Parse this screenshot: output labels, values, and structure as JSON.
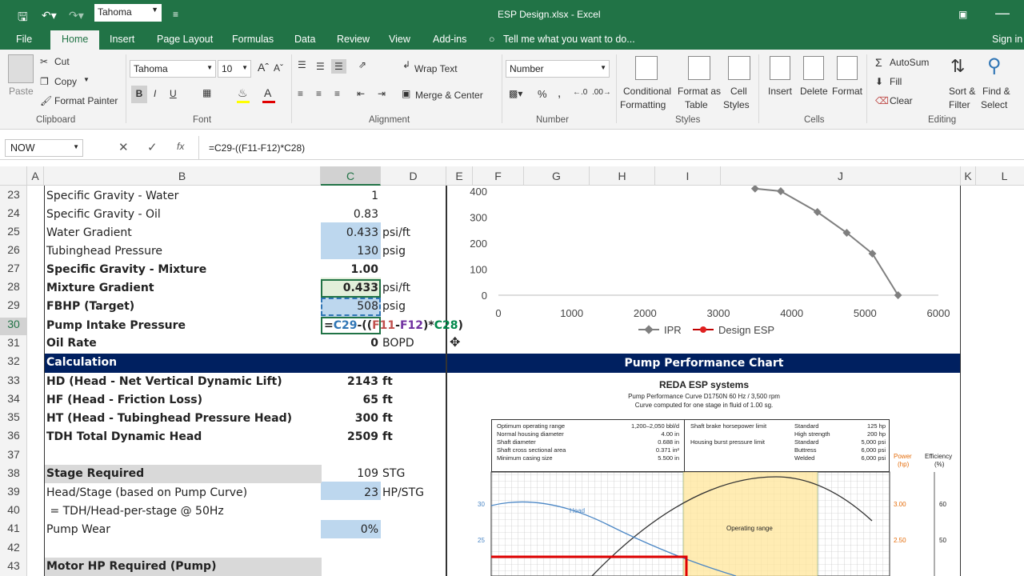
{
  "app": {
    "title": "ESP Design.xlsx - Excel",
    "font_box": "Tahoma",
    "signin": "Sign in"
  },
  "tabs": [
    "File",
    "Home",
    "Insert",
    "Page Layout",
    "Formulas",
    "Data",
    "Review",
    "View",
    "Add-ins"
  ],
  "tell_me": "Tell me what you want to do...",
  "ribbon": {
    "paste": "Paste",
    "cut": "Cut",
    "copy": "Copy",
    "format_painter": "Format Painter",
    "clipboard": "Clipboard",
    "font_name": "Tahoma",
    "font_size": "10",
    "bold": "B",
    "italic": "I",
    "underline": "U",
    "font": "Font",
    "wrap": "Wrap Text",
    "merge": "Merge & Center",
    "alignment": "Alignment",
    "numfmt": "Number",
    "number": "Number",
    "pct": "%",
    "comma": ",",
    "cond1": "Conditional",
    "cond2": "Formatting",
    "fat1": "Format as",
    "fat2": "Table",
    "cs1": "Cell",
    "cs2": "Styles",
    "styles": "Styles",
    "insert": "Insert",
    "delete": "Delete",
    "format": "Format",
    "cells": "Cells",
    "autosum": "AutoSum",
    "fill": "Fill",
    "clear": "Clear",
    "sort1": "Sort &",
    "sort2": "Filter",
    "find1": "Find &",
    "find2": "Select",
    "editing": "Editing"
  },
  "formula_bar": {
    "name_box": "NOW",
    "fx": "fx",
    "formula": "=C29-((F11-F12)*C28)"
  },
  "columns": [
    "A",
    "B",
    "C",
    "D",
    "E",
    "F",
    "G",
    "H",
    "I",
    "J",
    "K",
    "L"
  ],
  "rows": [
    "23",
    "24",
    "25",
    "26",
    "27",
    "28",
    "29",
    "30",
    "31",
    "32",
    "33",
    "34",
    "35",
    "36",
    "37",
    "38",
    "39",
    "40",
    "41",
    "42",
    "43"
  ],
  "cells": [
    {
      "b": "Specific Gravity - Water",
      "c": "1",
      "d": ""
    },
    {
      "b": "Specific Gravity - Oil",
      "c": "0.83",
      "d": ""
    },
    {
      "b": "Water Gradient",
      "c": "0.433",
      "d": "psi/ft"
    },
    {
      "b": "Tubinghead Pressure",
      "c": "130",
      "d": "psig"
    },
    {
      "b": "Specific Gravity - Mixture",
      "c": "1.00",
      "d": ""
    },
    {
      "b": "Mixture Gradient",
      "c": "0.433",
      "d": "psi/ft"
    },
    {
      "b": "FBHP (Target)",
      "c": "508",
      "d": "psig"
    },
    {
      "b": "Pump Intake Pressure",
      "c": "",
      "d": ""
    },
    {
      "b": "Oil Rate",
      "c": "0",
      "d": "BOPD"
    },
    {
      "b": "Calculation",
      "c": "",
      "d": ""
    },
    {
      "b": "HD (Head - Net Vertical Dynamic Lift)",
      "c": "2143",
      "d": "ft"
    },
    {
      "b": "HF (Head - Friction Loss)",
      "c": "65",
      "d": "ft"
    },
    {
      "b": "HT (Head - Tubinghead Pressure Head)",
      "c": "300",
      "d": "ft"
    },
    {
      "b": "TDH Total Dynamic Head",
      "c": "2509",
      "d": "ft"
    },
    {
      "b": "",
      "c": "",
      "d": ""
    },
    {
      "b": "Stage Required",
      "c": "109",
      "d": "STG"
    },
    {
      "b": "Head/Stage (based on Pump Curve)",
      "c": "23",
      "d": "HP/STG"
    },
    {
      "b": " = TDH/Head-per-stage @ 50Hz",
      "c": "",
      "d": ""
    },
    {
      "b": "Pump Wear",
      "c": "0%",
      "d": ""
    },
    {
      "b": "",
      "c": "",
      "d": ""
    },
    {
      "b": "Motor HP Required (Pump)",
      "c": "",
      "d": ""
    }
  ],
  "edit_formula": {
    "p1": "=",
    "p2": "C29",
    "p3": "-((",
    "p4": "F11",
    "p5": "-",
    "p6": "F12",
    "p7": ")*",
    "p8": "C28",
    "p9": ")"
  },
  "chart_data": {
    "type": "line",
    "ylim": [
      0,
      400
    ],
    "xlim": [
      0,
      6000
    ],
    "yticks": [
      "400",
      "300",
      "200",
      "100",
      "0"
    ],
    "xticks": [
      "0",
      "1000",
      "2000",
      "3000",
      "4000",
      "5000",
      "6000"
    ],
    "series": [
      {
        "name": "IPR",
        "x": [
          3500,
          3850,
          4350,
          4750,
          5100,
          5450
        ],
        "y": [
          410,
          400,
          320,
          240,
          160,
          0
        ]
      },
      {
        "name": "Design ESP",
        "x": [],
        "y": []
      }
    ],
    "legend": "bottom"
  },
  "pump_chart": {
    "header": "Pump Performance Chart",
    "title": "REDA ESP systems",
    "sub1": "Pump Performance Curve D1750N 60 Hz / 3,500 rpm",
    "sub2": "Curve computed for one stage in fluid of 1.00 sg.",
    "specs_left": [
      [
        "Optimum operating range",
        "1,200–2,050 bbl/d"
      ],
      [
        "Normal housing diameter",
        "4.00 in"
      ],
      [
        "Shaft diameter",
        "0.688 in"
      ],
      [
        "Shaft cross sectional area",
        "0.371 in²"
      ],
      [
        "Minimum casing size",
        "5.500 in"
      ]
    ],
    "specs_mid": [
      "Shaft brake horsepower limit",
      "",
      "Housing burst pressure limit"
    ],
    "specs_right": [
      [
        "Standard",
        "125 hp"
      ],
      [
        "High strength",
        "200 hp"
      ],
      [
        "Standard",
        "5,000 psi"
      ],
      [
        "Buttress",
        "6,000 psi"
      ],
      [
        "Welded",
        "6,000 psi"
      ]
    ],
    "power1": "Power",
    "power2": "(hp)",
    "eff1": "Efficiency",
    "eff2": "(%)",
    "head": "Head",
    "op_range": "Operating range",
    "y30": "30",
    "y25": "25",
    "p300": "3.00",
    "p250": "2.50",
    "e60": "60",
    "e50": "50"
  }
}
